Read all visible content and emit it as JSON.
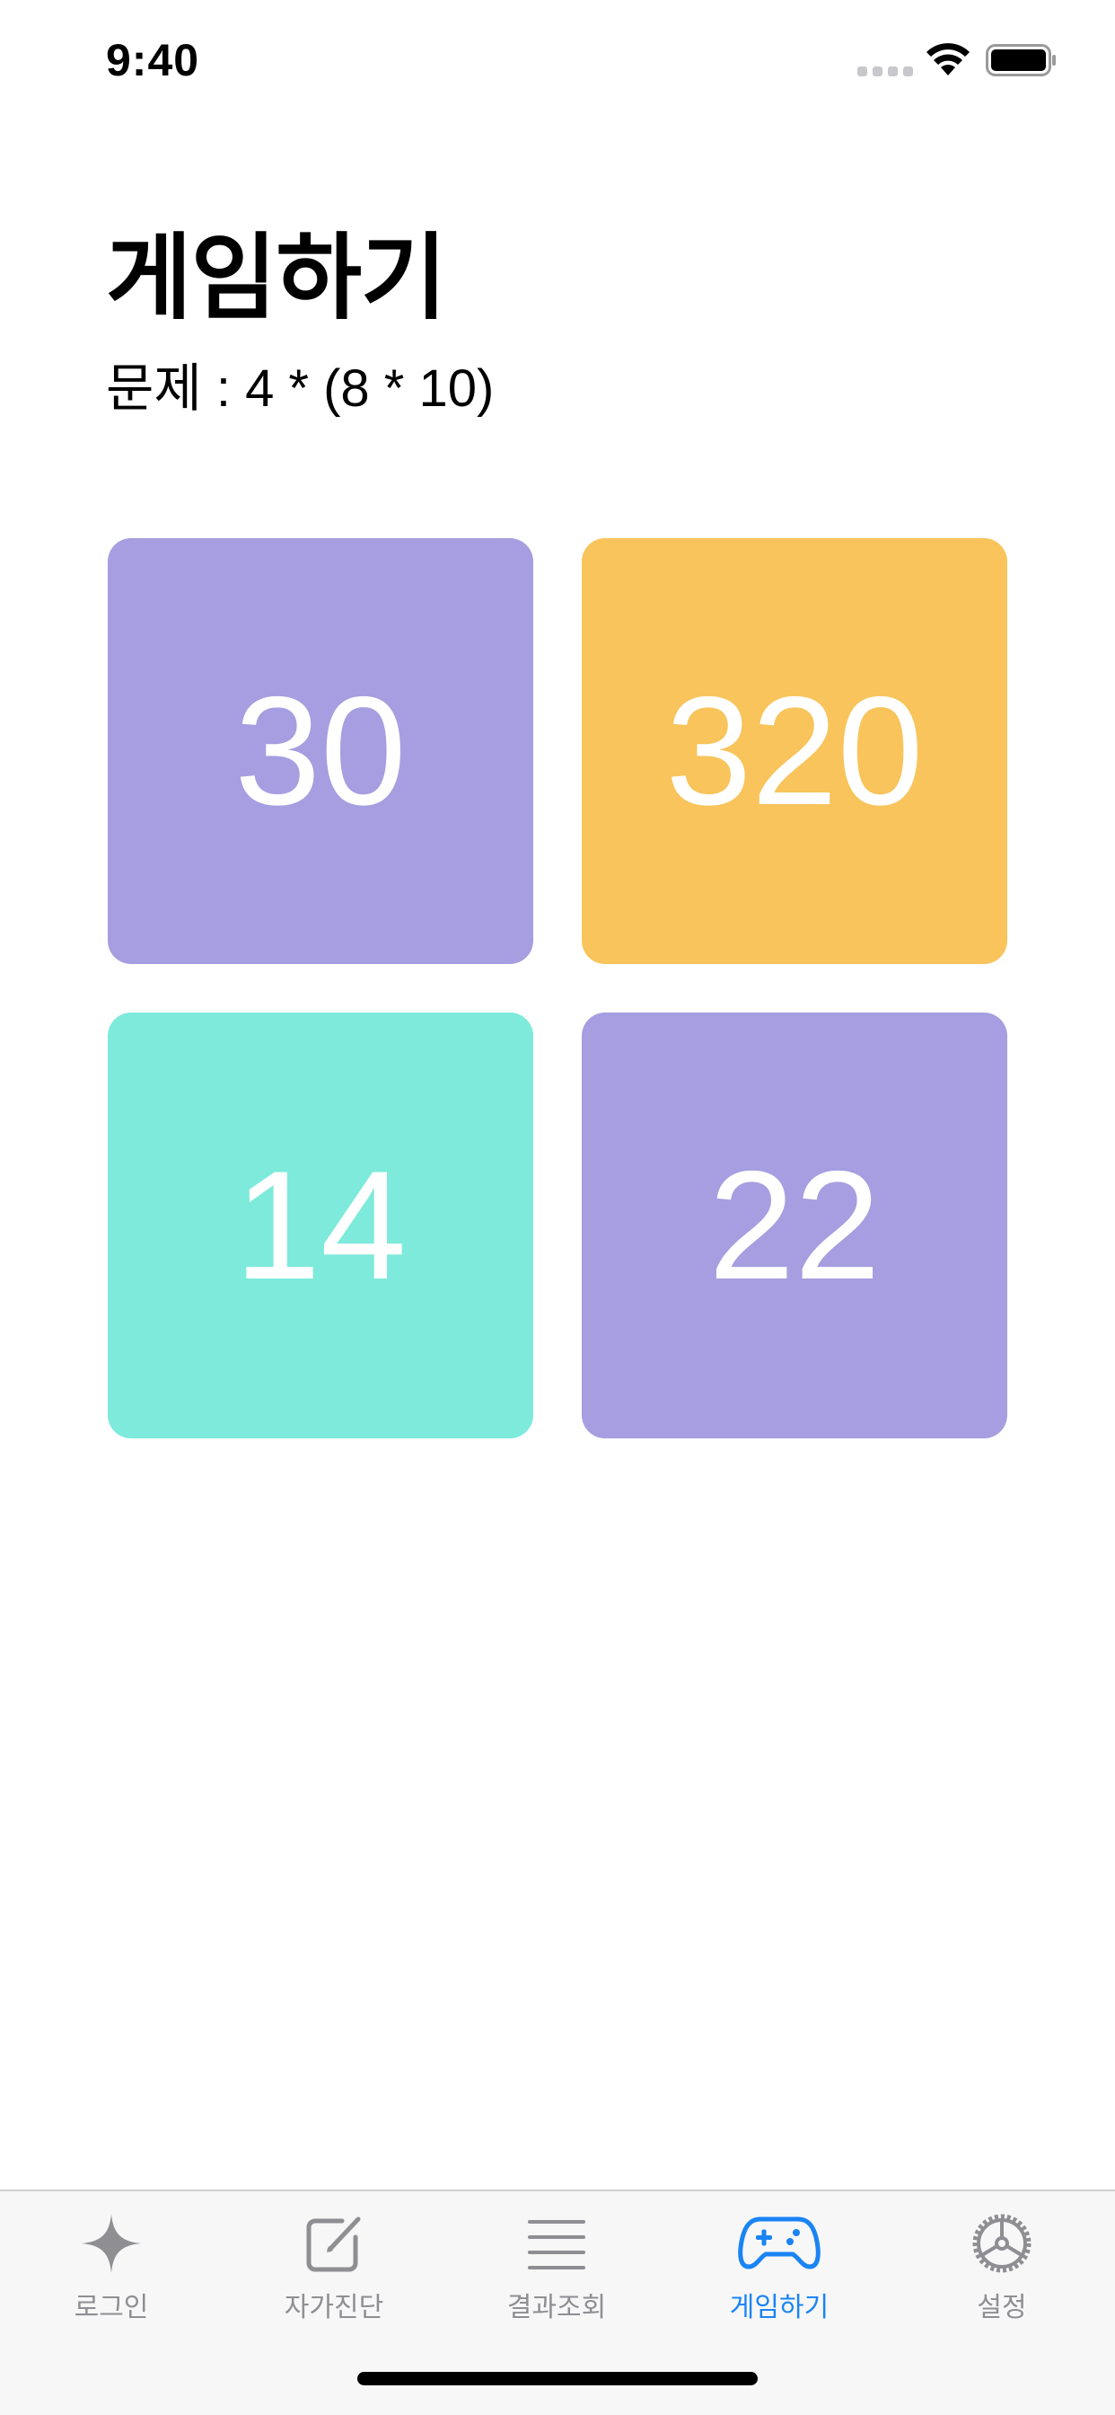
{
  "status_bar": {
    "time": "9:40"
  },
  "header": {
    "title": "게임하기",
    "problem": "문제 : 4 * (8 * 10)"
  },
  "answers": [
    {
      "value": "30",
      "color": "#a69ee0"
    },
    {
      "value": "320",
      "color": "#f8c45b"
    },
    {
      "value": "14",
      "color": "#7eeadb"
    },
    {
      "value": "22",
      "color": "#a69ee0"
    }
  ],
  "tab_bar": {
    "active_index": 3,
    "active_color": "#1a84f4",
    "inactive_color": "#8e8e93",
    "items": [
      {
        "label": "로그인",
        "icon": "sparkle-icon"
      },
      {
        "label": "자가진단",
        "icon": "compose-icon"
      },
      {
        "label": "결과조회",
        "icon": "list-icon"
      },
      {
        "label": "게임하기",
        "icon": "gamecontroller-icon"
      },
      {
        "label": "설정",
        "icon": "gear-icon"
      }
    ]
  }
}
